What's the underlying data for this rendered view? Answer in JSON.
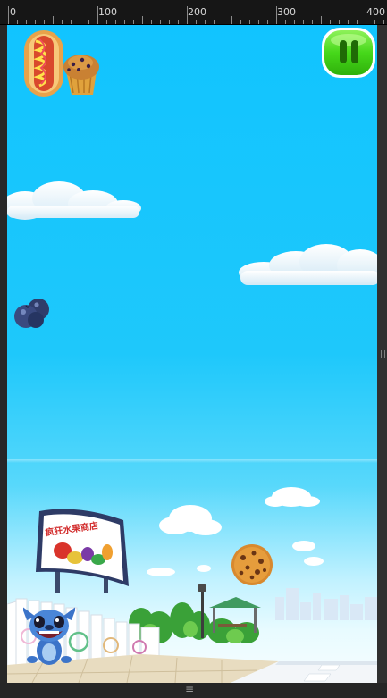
{
  "ruler": {
    "labels": [
      "0",
      "100",
      "200",
      "300",
      "400"
    ]
  },
  "game": {
    "billboard_text": "疯狂水果商店",
    "colors": {
      "sky_top": "#11c4ff",
      "pause_green": "#46d81a"
    }
  },
  "falling_items": [
    {
      "name": "hot-dog"
    },
    {
      "name": "muffin"
    },
    {
      "name": "blueberries"
    },
    {
      "name": "cookie"
    }
  ],
  "icons": [
    "pause-icon",
    "hot-dog-icon",
    "muffin-icon",
    "blueberry-icon",
    "cookie-icon",
    "stitch-character"
  ]
}
